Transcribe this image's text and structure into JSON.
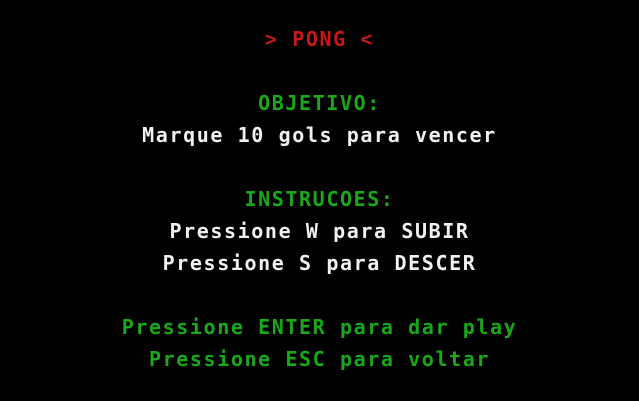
{
  "title": "> PONG <",
  "objective": {
    "heading": "OBJETIVO:",
    "text": "Marque 10 gols para vencer"
  },
  "instructions": {
    "heading": "INSTRUCOES:",
    "up": "Pressione W para SUBIR",
    "down": "Pressione S para DESCER"
  },
  "prompts": {
    "play": "Pressione ENTER para dar play",
    "back": "Pressione ESC para voltar"
  },
  "colors": {
    "background": "#000000",
    "title": "#c81818",
    "heading": "#18a818",
    "body": "#f0f0f0"
  }
}
